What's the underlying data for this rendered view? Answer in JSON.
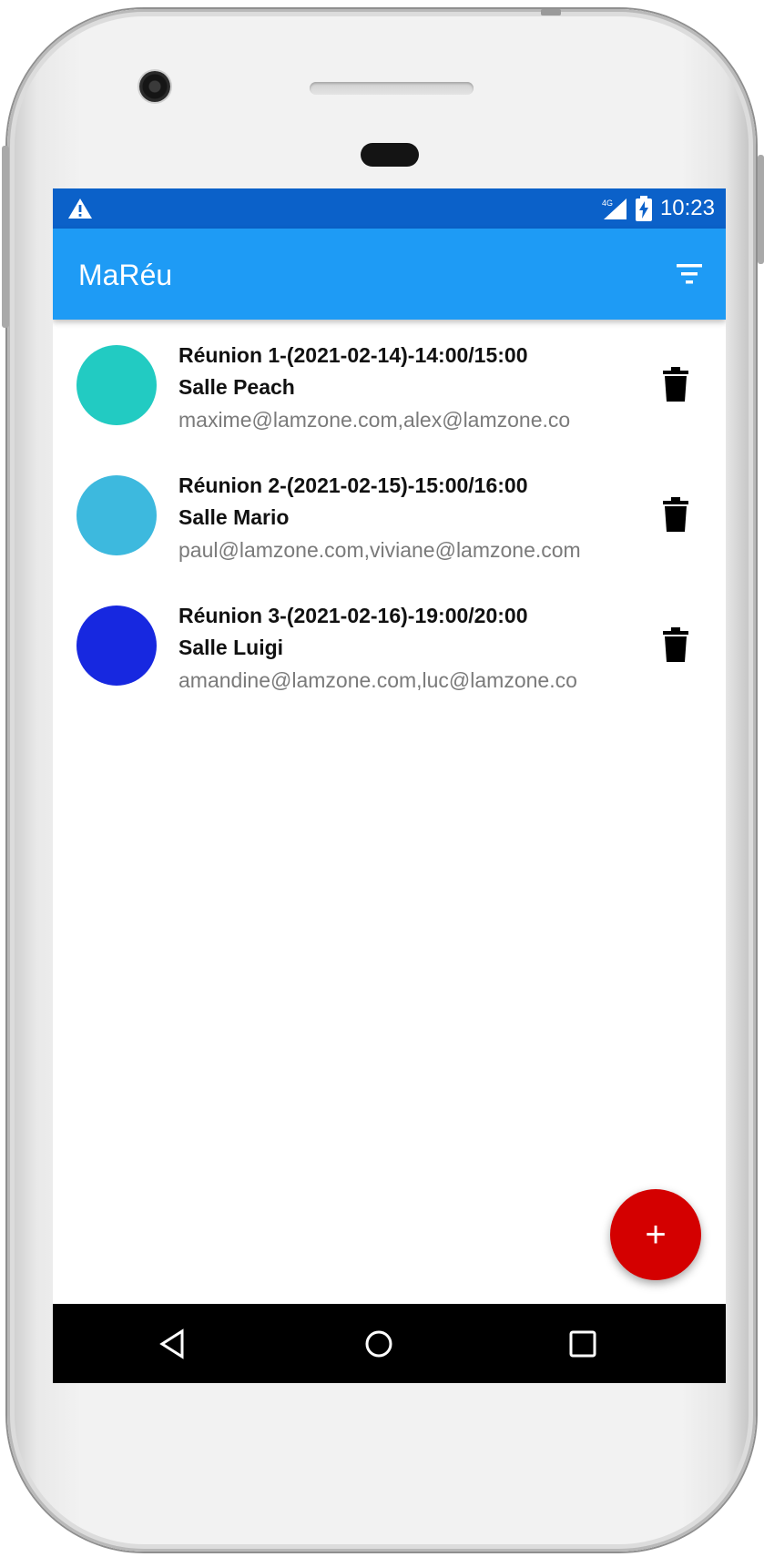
{
  "status_bar": {
    "time": "10:23",
    "network": "4G"
  },
  "app_bar": {
    "title": "MaRéu",
    "filter_icon": "filter-icon"
  },
  "meetings": [
    {
      "title": "Réunion 1-(2021-02-14)-14:00/15:00",
      "room": "Salle Peach",
      "participants": "maxime@lamzone.com,alex@lamzone.co",
      "color": "#22cbc2"
    },
    {
      "title": "Réunion 2-(2021-02-15)-15:00/16:00",
      "room": "Salle Mario",
      "participants": "paul@lamzone.com,viviane@lamzone.com",
      "color": "#3db9de"
    },
    {
      "title": "Réunion 3-(2021-02-16)-19:00/20:00",
      "room": "Salle Luigi",
      "participants": "amandine@lamzone.com,luc@lamzone.co",
      "color": "#1728e0"
    }
  ],
  "fab": {
    "label": "+",
    "color": "#d40000"
  },
  "colors": {
    "status_bar": "#0b61c9",
    "app_bar": "#1e9bf5"
  }
}
